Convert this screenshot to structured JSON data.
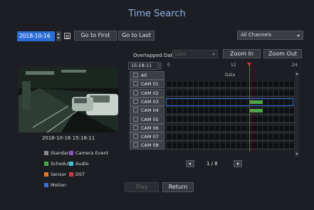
{
  "title": "Time Search",
  "date": "2018-10-16",
  "buttons": {
    "go_first": "Go to First",
    "go_last": "Go to Last",
    "zoom_in": "Zoom In",
    "zoom_out": "Zoom Out",
    "play": "Play",
    "return": "Return"
  },
  "channel_select": "All Channels",
  "overlapped": {
    "label": "Overlapped Data",
    "value": "List0"
  },
  "timeline": {
    "current_time": "15:18:11",
    "ticks": [
      "0",
      "12",
      "24"
    ],
    "header": "Data"
  },
  "video_caption": "2018-10-16 15:18:11",
  "channels": [
    "All",
    "CAM 01",
    "CAM 02",
    "CAM 03",
    "CAM 04",
    "CAM 05",
    "CAM 06",
    "CAM 07",
    "CAM 08"
  ],
  "legend": [
    {
      "label": "Standard",
      "color": "#8a8a8a"
    },
    {
      "label": "Camera Event",
      "color": "#8c53c6"
    },
    {
      "label": "Schedule",
      "color": "#4aa84a"
    },
    {
      "label": "Audio",
      "color": "#3cc4d8"
    },
    {
      "label": "Sensor",
      "color": "#e07a2a"
    },
    {
      "label": "DST",
      "color": "#d23b3b"
    },
    {
      "label": "Motion",
      "color": "#3b6fd8"
    }
  ],
  "page": "1 / 8",
  "colors": {
    "accent": "#2b6dd6",
    "cursor": "#d23b3b",
    "record": "#4aa84a"
  }
}
